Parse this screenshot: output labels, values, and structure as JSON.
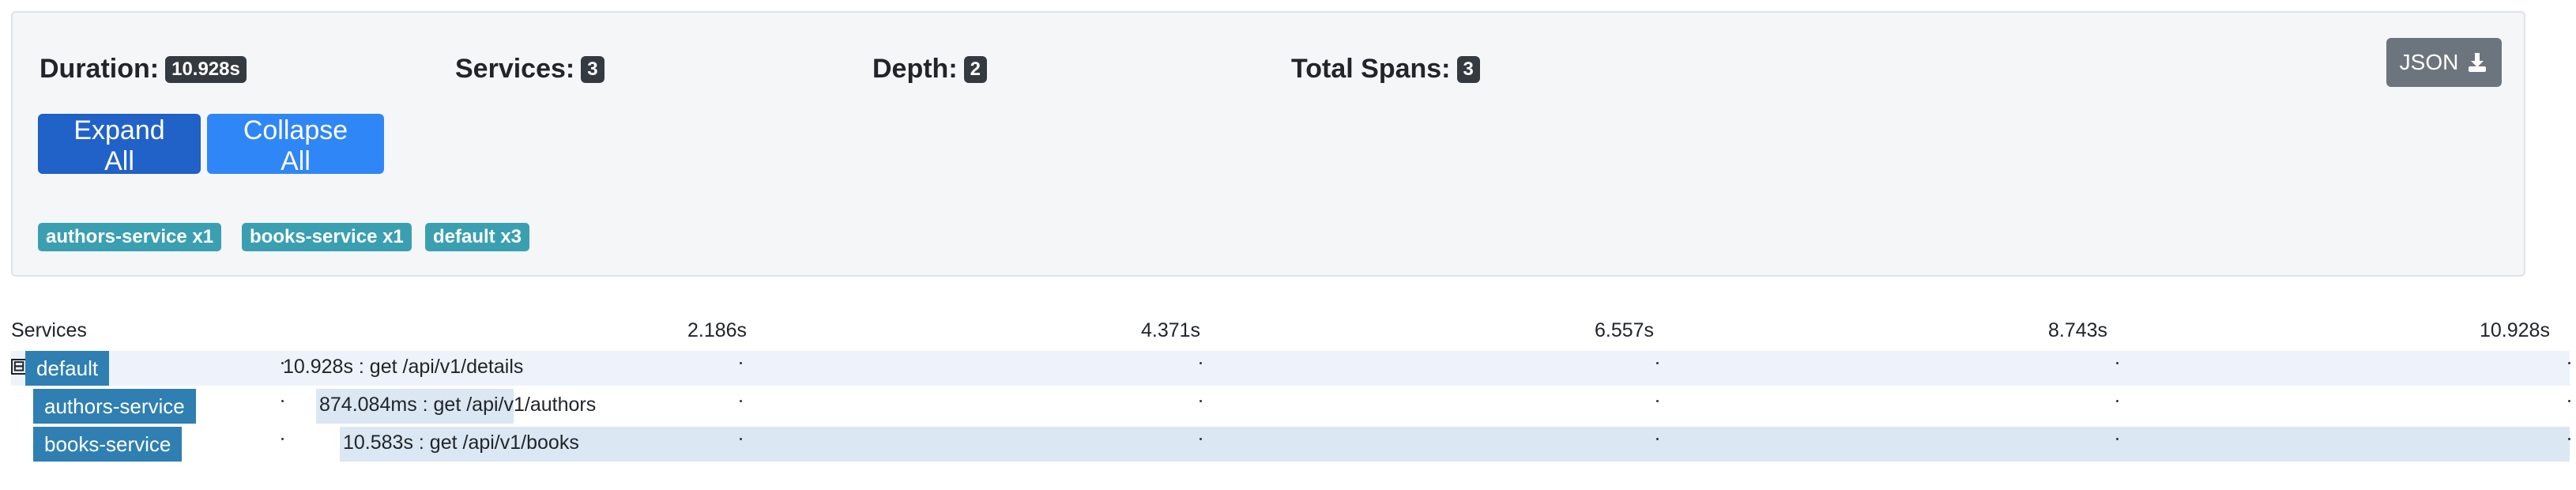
{
  "summary": {
    "duration_label": "Duration:",
    "duration_value": "10.928s",
    "services_label": "Services:",
    "services_value": "3",
    "depth_label": "Depth:",
    "depth_value": "2",
    "total_spans_label": "Total Spans:",
    "total_spans_value": "3",
    "json_button_label": "JSON",
    "json_icon": "download-icon",
    "expand_all_label": "Expand All",
    "collapse_all_label": "Collapse All",
    "tags": [
      "authors-service x1",
      "books-service x1",
      "default x3"
    ]
  },
  "timeline": {
    "header_label": "Services",
    "ticks": [
      "2.186s",
      "4.371s",
      "6.557s",
      "8.743s",
      "10.928s"
    ],
    "rows": [
      {
        "service": "default",
        "span_label": "10.928s : get /api/v1/details",
        "toggle": "⊟"
      },
      {
        "service": "authors-service",
        "span_label": "874.084ms : get /api/v1/authors"
      },
      {
        "service": "books-service",
        "span_label": "10.583s : get /api/v1/books"
      }
    ]
  }
}
